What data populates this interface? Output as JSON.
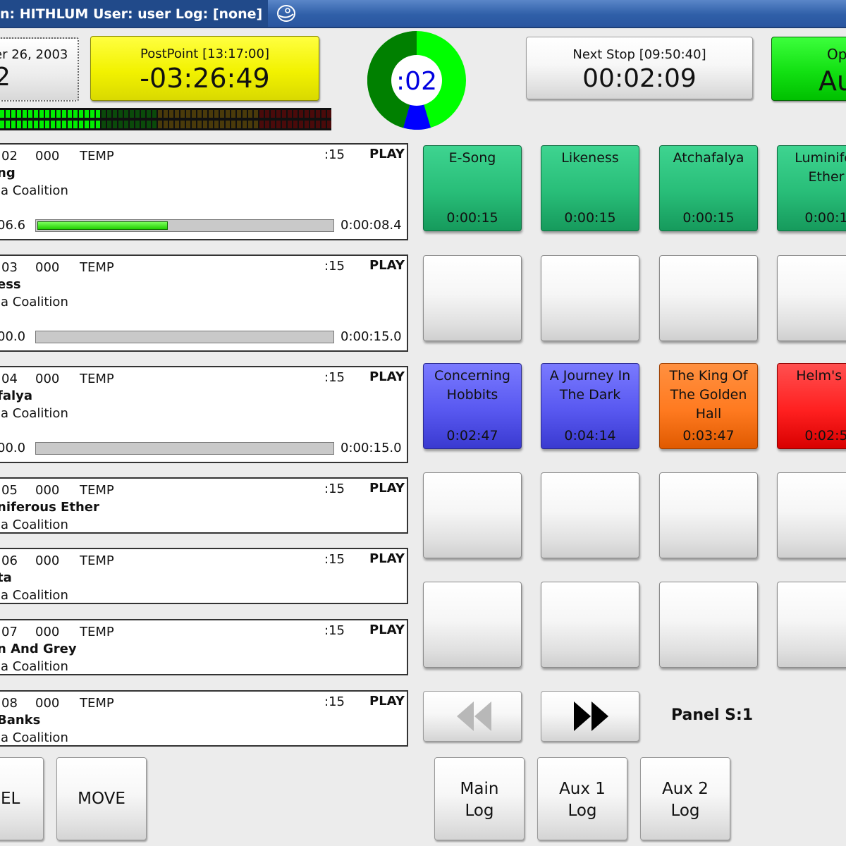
{
  "titlebar": {
    "caption": "n: HITHLUM  User: user  Log: [none]"
  },
  "clock": {
    "date": "er 26, 2003",
    "time": "2"
  },
  "postpoint": {
    "label": "PostPoint [13:17:00]",
    "value": "-03:26:49"
  },
  "pie": {
    "label": ":02",
    "colors": {
      "elapsed": "#00ff00",
      "remaining": "#008000",
      "talk": "#0000ff"
    }
  },
  "nextstop": {
    "label": "Next Stop [09:50:40]",
    "value": "00:02:09"
  },
  "opmode": {
    "label": "Op",
    "value": "Au"
  },
  "log": {
    "lines": [
      {
        "cart": "02",
        "cut": "000",
        "group": "TEMP",
        "length": ":15",
        "status": "PLAY",
        "title": "ng",
        "artist": "ia Coalition",
        "position": "06.6",
        "remaining": "0:00:08.4",
        "progress": 0.44,
        "show_progress": true
      },
      {
        "cart": "03",
        "cut": "000",
        "group": "TEMP",
        "length": ":15",
        "status": "PLAY",
        "title": "ess",
        "artist": "ia Coalition",
        "position": "00.0",
        "remaining": "0:00:15.0",
        "progress": 0,
        "show_progress": true
      },
      {
        "cart": "04",
        "cut": "000",
        "group": "TEMP",
        "length": ":15",
        "status": "PLAY",
        "title": "falya",
        "artist": "ia Coalition",
        "position": "00.0",
        "remaining": "0:00:15.0",
        "progress": 0,
        "show_progress": true
      },
      {
        "cart": "05",
        "cut": "000",
        "group": "TEMP",
        "length": ":15",
        "status": "PLAY",
        "title": "niferous Ether",
        "artist": "ia Coalition",
        "show_progress": false
      },
      {
        "cart": "06",
        "cut": "000",
        "group": "TEMP",
        "length": ":15",
        "status": "PLAY",
        "title": "ta",
        "artist": "ia Coalition",
        "show_progress": false
      },
      {
        "cart": "07",
        "cut": "000",
        "group": "TEMP",
        "length": ":15",
        "status": "PLAY",
        "title": "n And Grey",
        "artist": "ia Coalition",
        "show_progress": false
      },
      {
        "cart": "08",
        "cut": "000",
        "group": "TEMP",
        "length": ":15",
        "status": "PLAY",
        "title": "Banks",
        "artist": "ia Coalition",
        "show_progress": false
      }
    ]
  },
  "panel": {
    "row1": [
      {
        "title": "E-Song",
        "duration": "0:00:15",
        "color": "green"
      },
      {
        "title": "Likeness",
        "duration": "0:00:15",
        "color": "green"
      },
      {
        "title": "Atchafalya",
        "duration": "0:00:15",
        "color": "green"
      },
      {
        "title": "Luminifer Ether",
        "duration": "0:00:1",
        "color": "green"
      }
    ],
    "row3": [
      {
        "title": "Concerning Hobbits",
        "duration": "0:02:47",
        "color": "blue"
      },
      {
        "title": "A Journey In The Dark",
        "duration": "0:04:14",
        "color": "blue"
      },
      {
        "title": "The King Of The Golden Hall",
        "duration": "0:03:47",
        "color": "orange"
      },
      {
        "title": "Helm's D",
        "duration": "0:02:5",
        "color": "red"
      }
    ],
    "label": "Panel S:1",
    "prev_icon": "rewind-icon",
    "next_icon": "fast-forward-icon"
  },
  "bottom": {
    "del_label": "EL",
    "move_label": "MOVE",
    "main_log": [
      "Main",
      "Log"
    ],
    "aux1_log": [
      "Aux 1",
      "Log"
    ],
    "aux2_log": [
      "Aux 2",
      "Log"
    ]
  }
}
